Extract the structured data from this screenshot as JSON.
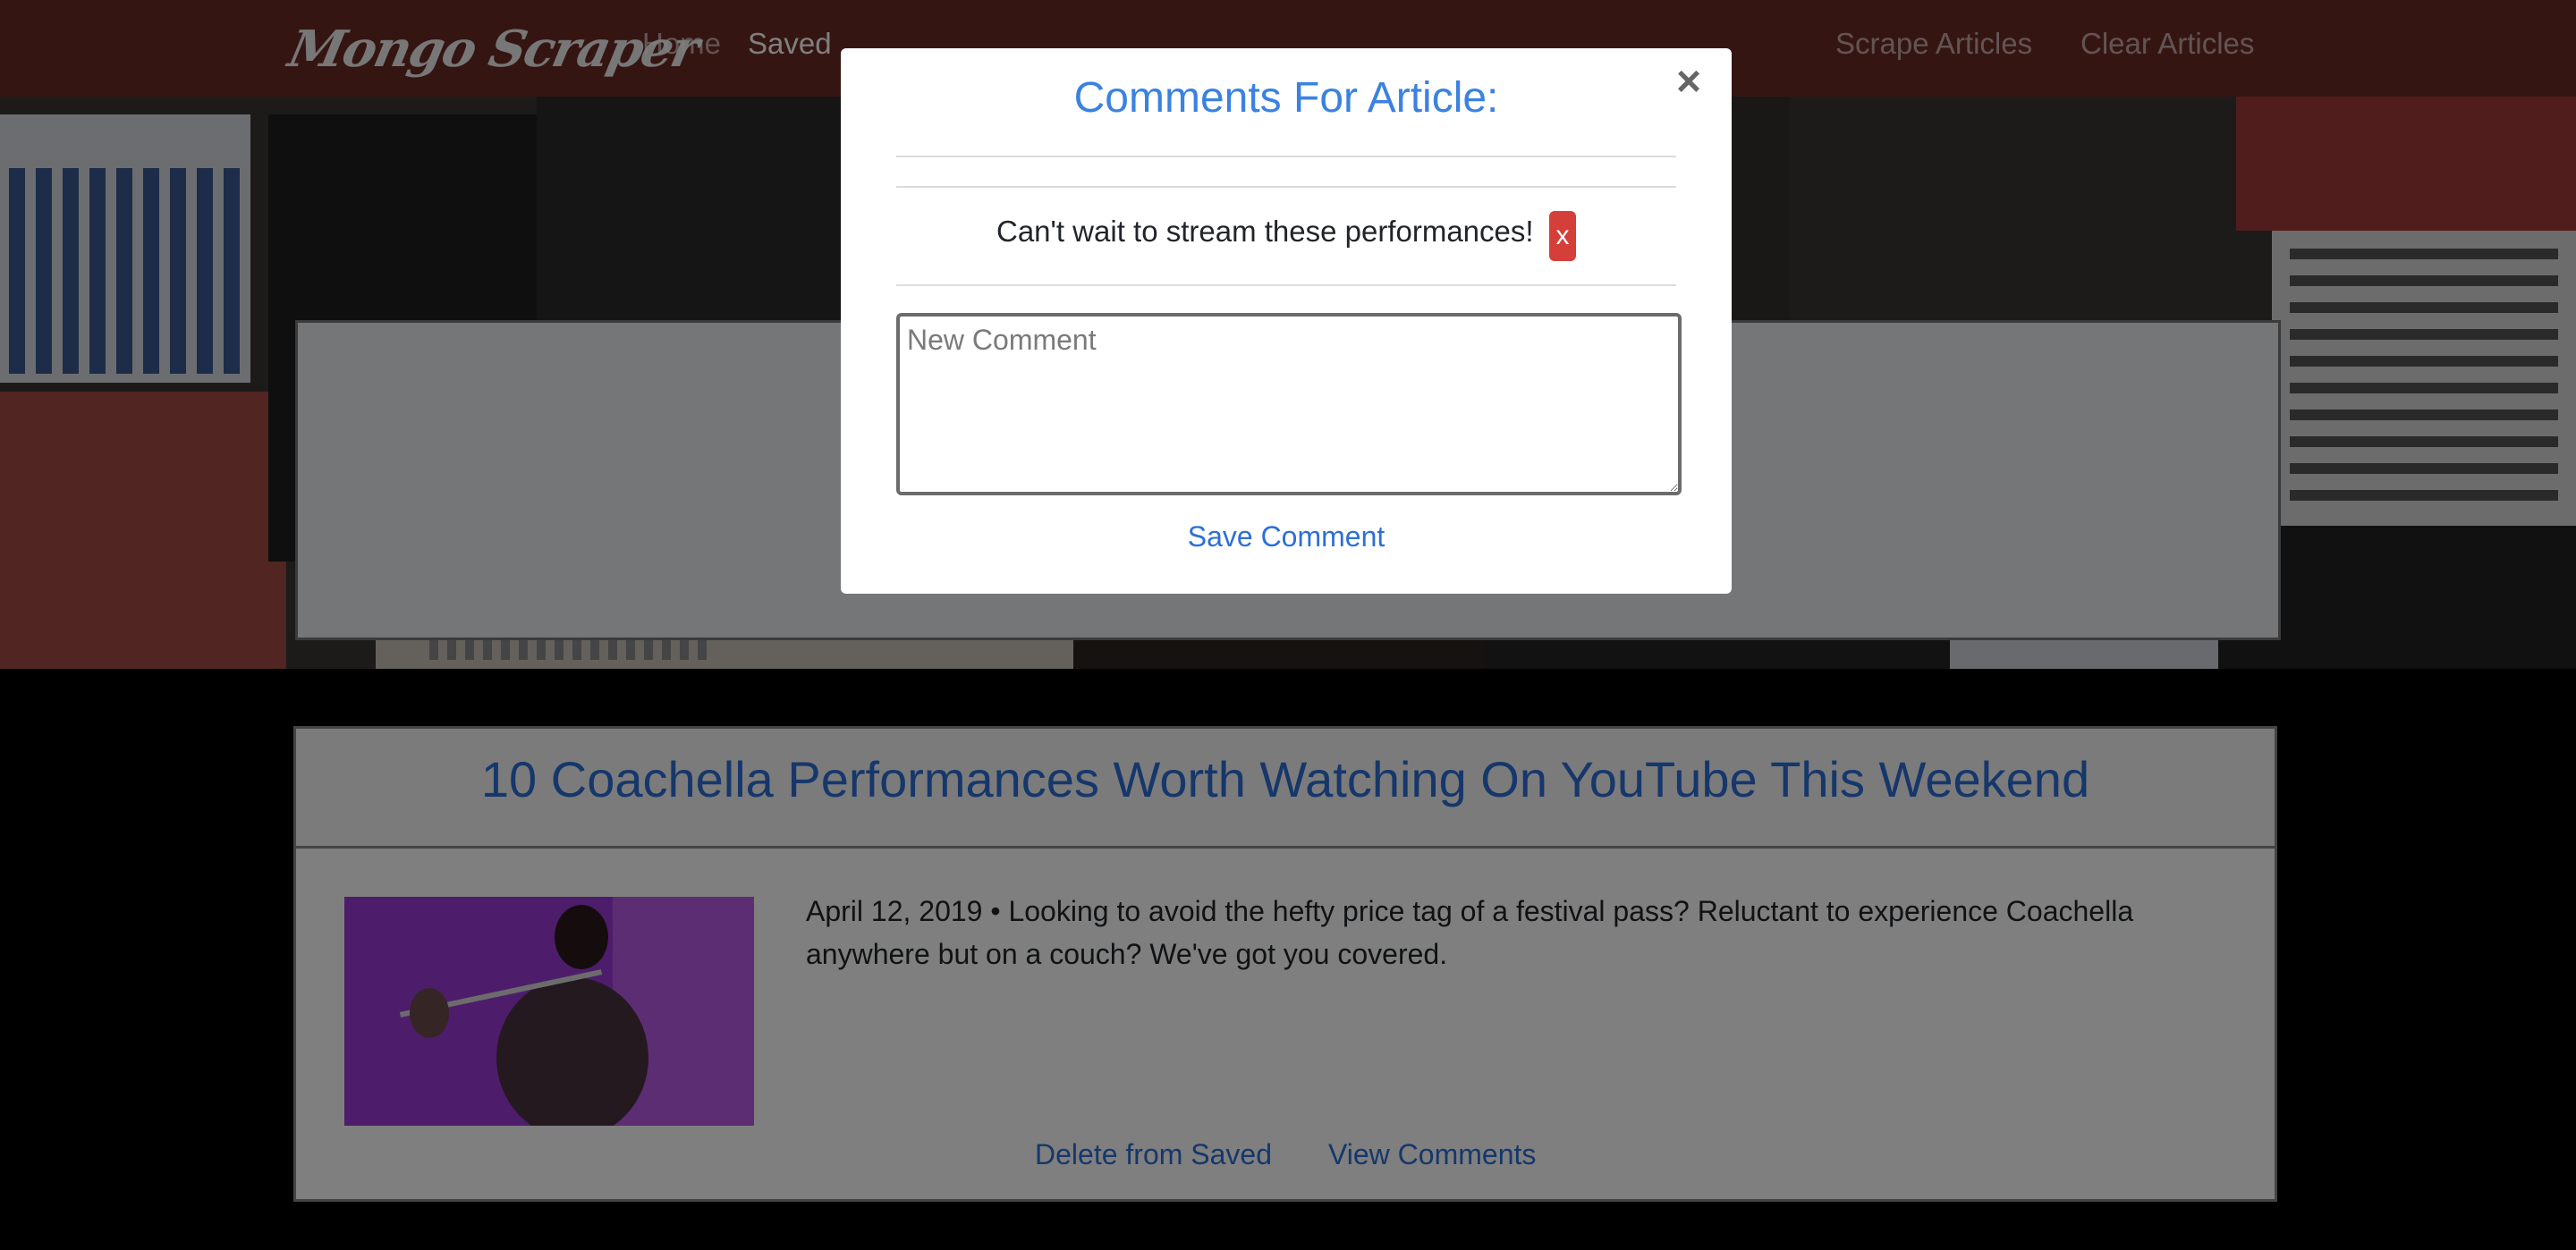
{
  "navbar": {
    "brand": "Mongo Scraper",
    "home": "Home",
    "saved": "Saved",
    "scrape": "Scrape Articles",
    "clear": "Clear Articles",
    "bg_color": "#6b2a25"
  },
  "article": {
    "title": "10 Coachella Performances Worth Watching On YouTube This Weekend",
    "summary": "April 12, 2019 • Looking to avoid the hefty price tag of a festival pass? Reluctant to experience Coachella anywhere but on a couch? We've got you covered.",
    "delete_label": "Delete from Saved",
    "view_label": "View Comments"
  },
  "modal": {
    "title": "Comments For Article:",
    "close_symbol": "×",
    "comments": [
      {
        "text": "Can't wait to stream these performances!",
        "delete_label": "x"
      }
    ],
    "input_placeholder": "New Comment",
    "save_label": "Save Comment",
    "accent": "#3b82e0"
  }
}
